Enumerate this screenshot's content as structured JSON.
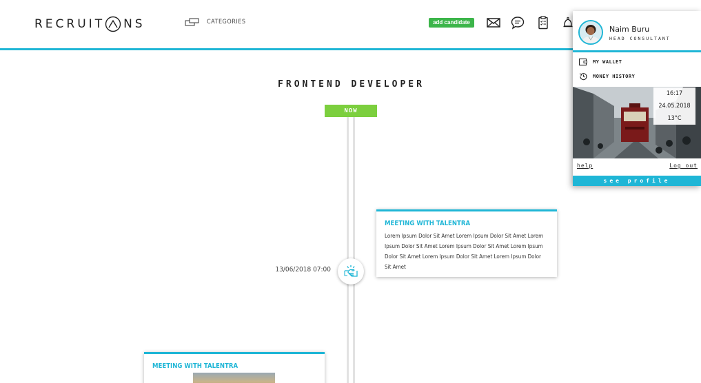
{
  "header": {
    "logo_text_start": "RECRUIT",
    "logo_text_end": "NS",
    "categories_label": "CATEGORIES",
    "add_candidate_label": "add candidate",
    "icons": [
      "envelope-icon",
      "chat-icon",
      "clipboard-icon",
      "bell-icon"
    ]
  },
  "main": {
    "page_title": "FRONTEND DEVELOPER",
    "now_label": "NOW",
    "events": [
      {
        "date": "13/06/2018 07:00",
        "title": "MEETING WITH TALENTRA",
        "body": "Lorem Ipsum Dolor Sit Amet Lorem Ipsum Dolor Sit Amet Lorem Ipsum Dolor Sit Amet Lorem Ipsum Dolor Sit Amet Lorem Ipsum Dolor Sit Amet Lorem Ipsum Dolor Sit Amet Lorem Ipsum Dolor Sit Amet"
      },
      {
        "title": "MEETING WITH TALENTRA"
      }
    ]
  },
  "profile": {
    "name": "Naim Buru",
    "role": "HEAD CONSULTANT",
    "menu": {
      "wallet": "MY WALLET",
      "money_history": "MONEY HISTORY"
    },
    "weather": {
      "time": "16:17",
      "date": "24.05.2018",
      "temperature": "13°C"
    },
    "help_label": "help",
    "logout_label": "Log out",
    "see_profile_label": "see profile"
  },
  "colors": {
    "accent": "#1fb6d6",
    "add_button": "#3cb54a",
    "now_badge": "#7ccf3e"
  }
}
